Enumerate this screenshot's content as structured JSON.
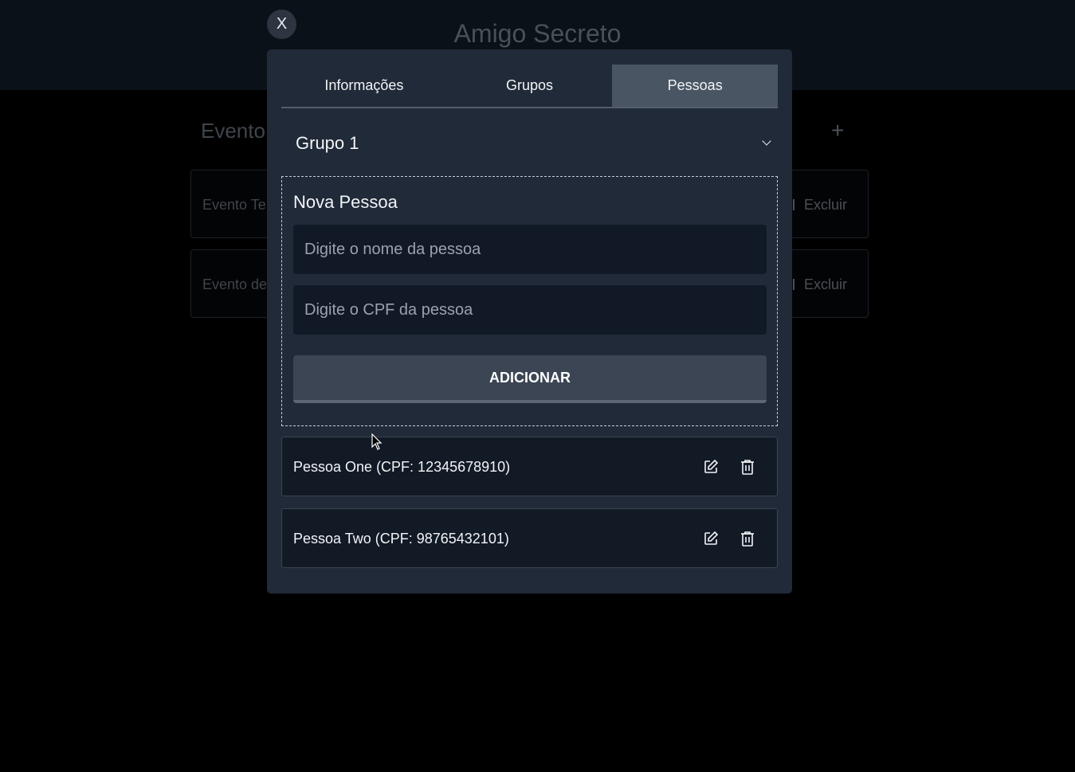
{
  "app": {
    "title": "Amigo Secreto",
    "section_title": "Evento",
    "add_symbol": "+",
    "events": [
      {
        "name": "Evento Te",
        "delete_label": "Excluir"
      },
      {
        "name": "Evento de",
        "delete_label": "Excluir"
      }
    ]
  },
  "modal": {
    "close_label": "X",
    "tabs": [
      {
        "label": "Informações",
        "active": false
      },
      {
        "label": "Grupos",
        "active": false
      },
      {
        "label": "Pessoas",
        "active": true
      }
    ],
    "group_select": {
      "value": "Grupo 1"
    },
    "new_person": {
      "title": "Nova Pessoa",
      "name_placeholder": "Digite o nome da pessoa",
      "cpf_placeholder": "Digite o CPF da pessoa",
      "submit_label": "ADICIONAR"
    },
    "people": [
      {
        "label": "Pessoa One (CPF: 12345678910)",
        "edit_icon": "edit-icon",
        "delete_icon": "trash-icon"
      },
      {
        "label": "Pessoa Two (CPF: 98765432101)",
        "edit_icon": "edit-icon",
        "delete_icon": "trash-icon"
      }
    ]
  },
  "colors": {
    "modal_bg": "#202a38",
    "active_tab": "#4a5563",
    "input_bg": "#111927",
    "button_bg": "#3b4554"
  }
}
